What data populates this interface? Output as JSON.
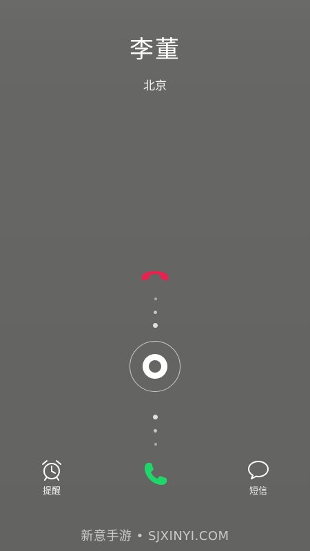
{
  "caller": {
    "name": "李董",
    "location": "北京"
  },
  "actions": {
    "decline_icon": "hang-up-icon",
    "answer_icon": "phone-icon",
    "remind_label": "提醒",
    "remind_icon": "alarm-clock-icon",
    "sms_label": "短信",
    "sms_icon": "chat-bubble-icon"
  },
  "watermark": "新意手游 • SJXINYI.COM",
  "colors": {
    "background": "#666664",
    "decline": "#e8214f",
    "answer": "#1fd66b",
    "text": "#ffffff"
  }
}
